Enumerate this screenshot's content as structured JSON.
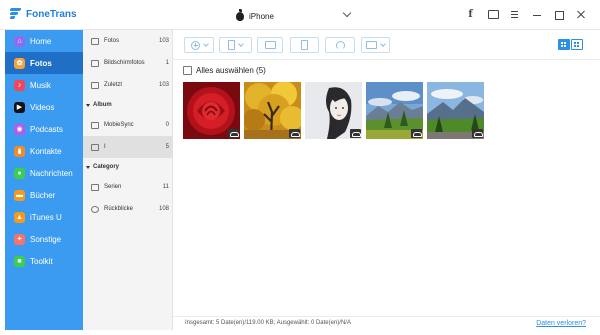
{
  "app": {
    "name": "FoneTrans",
    "device": "iPhone",
    "brand_color": "#3a9bf0",
    "active_color": "#1f6fc7"
  },
  "window_controls": [
    "facebook-icon",
    "chat-icon",
    "menu-icon",
    "minimize-icon",
    "maximize-icon",
    "close-icon"
  ],
  "sidebar": {
    "items": [
      {
        "label": "Home",
        "icon": "home-icon",
        "color": "#8e6cf0",
        "glyph": "⌂"
      },
      {
        "label": "Fotos",
        "icon": "photos-icon",
        "color": "#f6a33a",
        "glyph": "✿",
        "active": true
      },
      {
        "label": "Musik",
        "icon": "music-icon",
        "color": "#f0475a",
        "glyph": "♪"
      },
      {
        "label": "Videos",
        "icon": "videos-icon",
        "color": "#111111",
        "glyph": "▶"
      },
      {
        "label": "Podcasts",
        "icon": "podcasts-icon",
        "color": "#b45be8",
        "glyph": "◉"
      },
      {
        "label": "Kontakte",
        "icon": "contacts-icon",
        "color": "#f08a2a",
        "glyph": "▮"
      },
      {
        "label": "Nachrichten",
        "icon": "messages-icon",
        "color": "#3ccf4e",
        "glyph": "●"
      },
      {
        "label": "Bücher",
        "icon": "books-icon",
        "color": "#f59a1d",
        "glyph": "▬"
      },
      {
        "label": "iTunes U",
        "icon": "itunes-u-icon",
        "color": "#f59a1d",
        "glyph": "▲"
      },
      {
        "label": "Sonstige",
        "icon": "other-icon",
        "color": "#f7726b",
        "glyph": "✦"
      },
      {
        "label": "Toolkit",
        "icon": "toolkit-icon",
        "color": "#3ccf4e",
        "glyph": "■"
      }
    ]
  },
  "subpanel": {
    "items": [
      {
        "label": "Fotos",
        "count": "103"
      },
      {
        "label": "Bildschirmfotos",
        "count": "1"
      },
      {
        "label": "Zuletzt",
        "count": "103"
      }
    ],
    "album_heading": "Album",
    "albums": [
      {
        "label": "MobieSync",
        "count": "0"
      },
      {
        "label": "I",
        "count": "5",
        "active": true
      }
    ],
    "category_heading": "Category",
    "categories": [
      {
        "label": "Serien",
        "count": "11"
      },
      {
        "label": "Rückblicke",
        "count": "108"
      }
    ]
  },
  "toolbar": {
    "buttons": [
      "add-icon",
      "export-to-device-icon",
      "export-to-pc-icon",
      "delete-icon",
      "sync-icon",
      "toolbox-icon"
    ],
    "view": "grid"
  },
  "content": {
    "select_all_label": "Alles auswählen (5)",
    "photos": [
      "red-rose-photo",
      "autumn-tree-photo",
      "portrait-photo",
      "mountain-meadow-photo",
      "alpine-landscape-photo"
    ]
  },
  "status": {
    "summary": "Insgesamt: 5 Date(en)/119.00 KB; Ausgewählt: 0 Date(en)/N/A",
    "link": "Daten verloren?"
  }
}
